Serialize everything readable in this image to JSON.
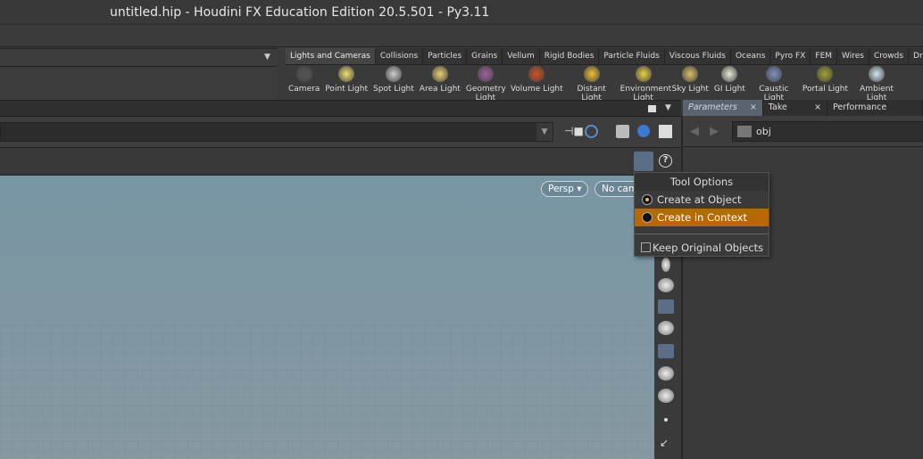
{
  "window": {
    "title": "untitled.hip - Houdini FX Education Edition 20.5.501 - Py3.11"
  },
  "shelf": {
    "tabs": [
      "Lights and Cameras",
      "Collisions",
      "Particles",
      "Grains",
      "Vellum",
      "Rigid Bodies",
      "Particle Fluids",
      "Viscous Fluids",
      "Oceans",
      "Pyro FX",
      "FEM",
      "Wires",
      "Crowds",
      "Driv"
    ],
    "active_tab": "Lights and Cameras",
    "tools": [
      {
        "label": "Camera",
        "icon": "camera-icon",
        "color": "#555"
      },
      {
        "label": "Point Light",
        "icon": "point-light-icon",
        "color": "#f0e070"
      },
      {
        "label": "Spot Light",
        "icon": "spot-light-icon",
        "color": "#ccc"
      },
      {
        "label": "Area Light",
        "icon": "area-light-icon",
        "color": "#e8d070"
      },
      {
        "label": "Geometry Light",
        "icon": "geometry-light-icon",
        "color": "#a060a0"
      },
      {
        "label": "Volume Light",
        "icon": "volume-light-icon",
        "color": "#d05020"
      },
      {
        "label": "Distant Light",
        "icon": "distant-light-icon",
        "color": "#f0c030"
      },
      {
        "label": "Environment Light",
        "icon": "environment-light-icon",
        "color": "#e8d040"
      },
      {
        "label": "Sky Light",
        "icon": "sky-light-icon",
        "color": "#d8c060"
      },
      {
        "label": "GI Light",
        "icon": "gi-light-icon",
        "color": "#e8e8d8"
      },
      {
        "label": "Caustic Light",
        "icon": "caustic-light-icon",
        "color": "#8090c0"
      },
      {
        "label": "Portal Light",
        "icon": "portal-light-icon",
        "color": "#a0a030"
      },
      {
        "label": "Ambient Light",
        "icon": "ambient-light-icon",
        "color": "#d0e8f0"
      }
    ]
  },
  "right_pane": {
    "tabs": [
      "Parameters",
      "Take List",
      "Performance Monitor"
    ],
    "active_tab": "Parameters",
    "close": "×",
    "path": "obj"
  },
  "viewport": {
    "view_label": "Persp",
    "camera_label": "No cam"
  },
  "tool_options_menu": {
    "title": "Tool Options",
    "items": [
      {
        "label": "Create at Object Level",
        "type": "radio",
        "selected": true
      },
      {
        "label": "Create in Context",
        "type": "radio",
        "selected": false,
        "highlighted": true
      },
      {
        "label": "Keep Original Objects",
        "type": "checkbox",
        "checked": false
      }
    ]
  },
  "colors": {
    "accent_highlight": "#b86800",
    "active_tab": "#5a6470"
  }
}
